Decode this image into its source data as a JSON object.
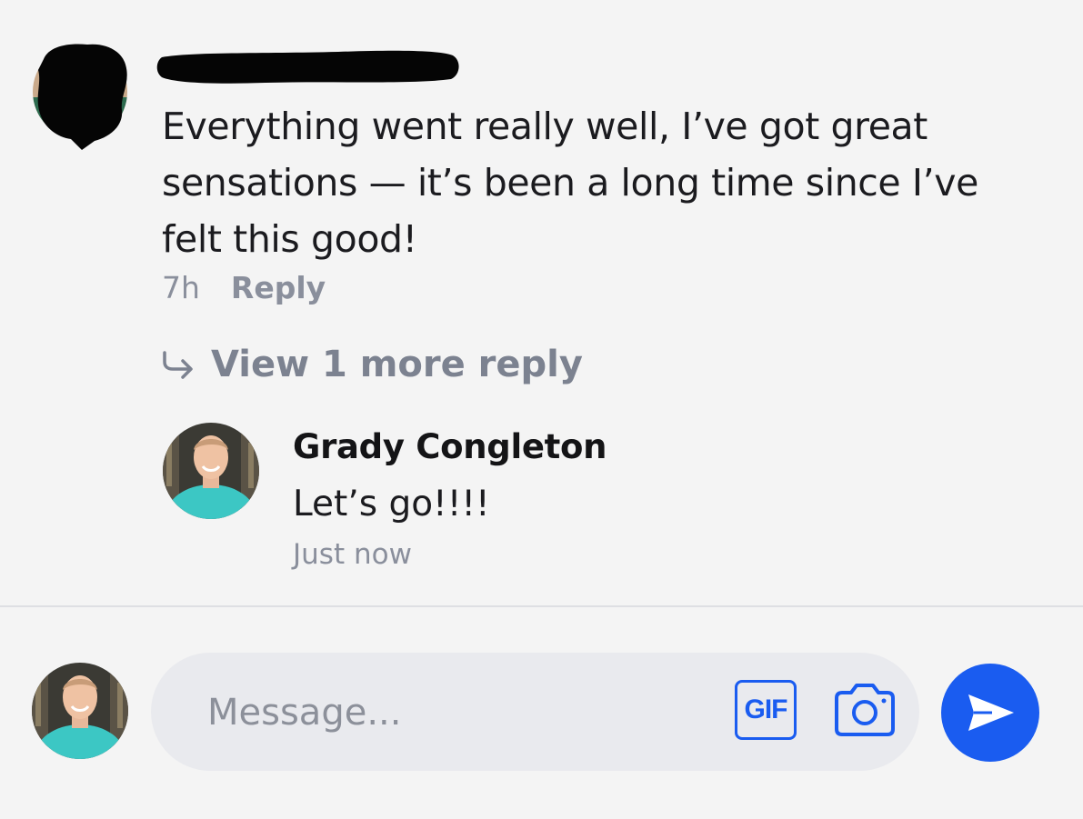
{
  "comment": {
    "text": "Everything went really well, I’ve got great sensations — it’s been a long time since I’ve felt this good!",
    "time": "7h",
    "reply_label": "Reply"
  },
  "view_more": {
    "label": "View 1 more reply",
    "icon": "reply-arrow-icon"
  },
  "reply": {
    "author": "Grady Congleton",
    "text": "Let’s go!!!!",
    "time": "Just now"
  },
  "composer": {
    "placeholder": "Message...",
    "gif_label": "GIF",
    "camera_icon": "camera-icon",
    "send_icon": "send-icon"
  },
  "colors": {
    "accent": "#1a5cf0",
    "background": "#f4f4f4",
    "input_background": "#e9eaee",
    "muted_text": "#8a8f9c"
  }
}
